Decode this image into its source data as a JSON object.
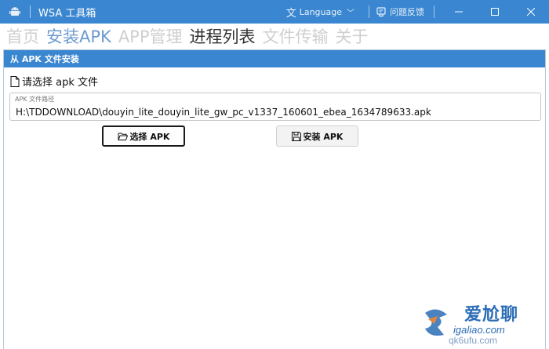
{
  "window": {
    "title": "WSA 工具箱",
    "language_label": "Language",
    "feedback_label": "问题反馈",
    "accent_color": "#3a86d0"
  },
  "tabs": [
    {
      "label": "首页",
      "state": "inactive"
    },
    {
      "label": "安装APK",
      "state": "selected"
    },
    {
      "label": "APP管理",
      "state": "inactive"
    },
    {
      "label": "进程列表",
      "state": "current"
    },
    {
      "label": "文件传输",
      "state": "inactive"
    },
    {
      "label": "关于",
      "state": "inactive"
    }
  ],
  "panel": {
    "header": "从 APK 文件安装",
    "select_label": "请选择 apk 文件",
    "path_caption": "APK 文件路径",
    "path_value": "H:\\TDDOWNLOAD\\douyin_lite_douyin_lite_gw_pc_v1337_160601_ebea_1634789633.apk",
    "select_button": "选择 APK",
    "install_button": "安装 APK"
  },
  "watermark": {
    "title": "爱尬聊",
    "url": "igaliao.com",
    "url2": "qk6ufu.com"
  },
  "icons": {
    "app": "android-icon",
    "language": "translate-icon",
    "feedback": "bug-report-icon",
    "file": "file-icon",
    "folder": "folder-open-icon",
    "save": "save-icon"
  }
}
